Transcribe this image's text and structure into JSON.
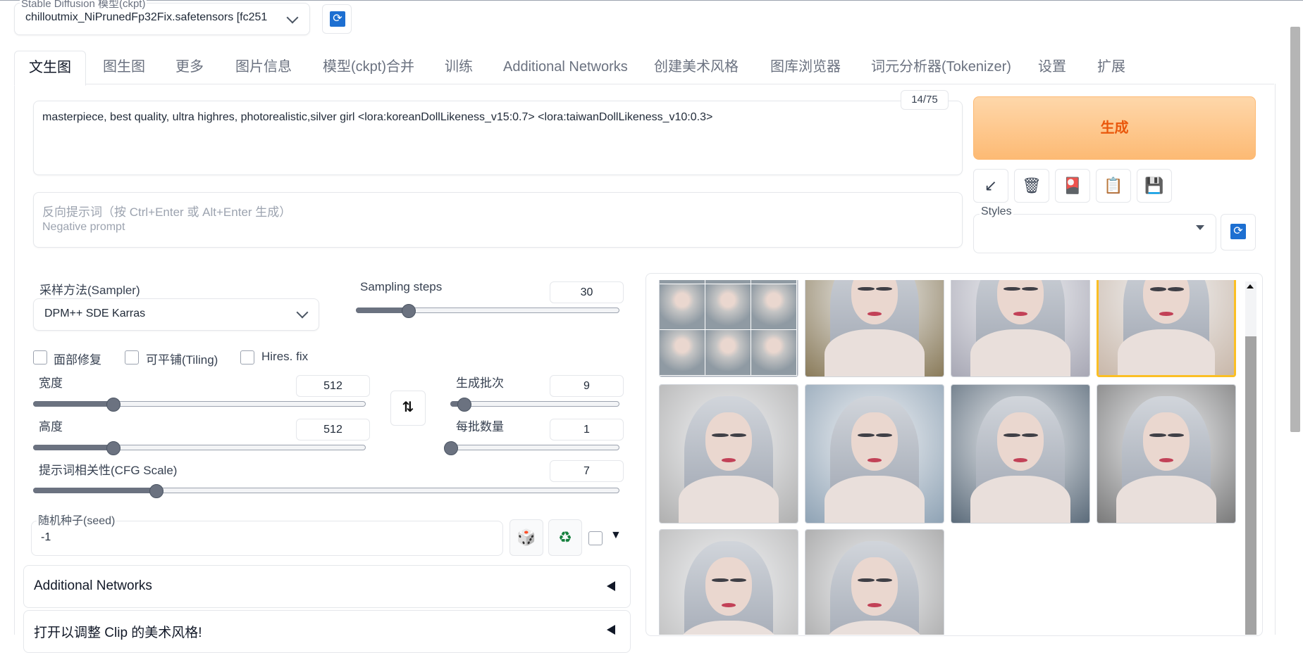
{
  "model": {
    "label": "Stable Diffusion 模型(ckpt)",
    "value": "chilloutmix_NiPrunedFp32Fix.safetensors [fc251"
  },
  "tabs": [
    {
      "label": "文生图",
      "active": true
    },
    {
      "label": "图生图"
    },
    {
      "label": "更多"
    },
    {
      "label": "图片信息"
    },
    {
      "label": "模型(ckpt)合并"
    },
    {
      "label": "训练"
    },
    {
      "label": "Additional Networks"
    },
    {
      "label": "创建美术风格"
    },
    {
      "label": "图库浏览器"
    },
    {
      "label": "词元分析器(Tokenizer)"
    },
    {
      "label": "设置"
    },
    {
      "label": "扩展"
    }
  ],
  "prompt": {
    "value": "masterpiece, best quality, ultra highres, photorealistic,silver girl <lora:koreanDollLikeness_v15:0.7> <lora:taiwanDollLikeness_v10:0.3>",
    "token_count": "14/75"
  },
  "negative_prompt": {
    "placeholder_line1": "反向提示词（按 Ctrl+Enter 或 Alt+Enter 生成）",
    "placeholder_line2": "Negative prompt"
  },
  "generate": {
    "label": "生成"
  },
  "tools": {
    "icons": [
      "arrow-icon",
      "trash-icon",
      "card-icon",
      "clipboard-icon",
      "save-icon"
    ],
    "glyphs": [
      "↙",
      "🗑",
      "🎴",
      "📋",
      "💾"
    ]
  },
  "styles": {
    "label": "Styles",
    "value": ""
  },
  "sampler": {
    "label": "采样方法(Sampler)",
    "value": "DPM++ SDE Karras"
  },
  "sampling_steps": {
    "label": "Sampling steps",
    "value": "30",
    "fraction": 0.2
  },
  "checkboxes": {
    "restore_faces": "面部修复",
    "tiling": "可平铺(Tiling)",
    "hires_fix": "Hires. fix"
  },
  "width": {
    "label": "宽度",
    "value": "512",
    "fraction": 0.24
  },
  "height": {
    "label": "高度",
    "value": "512",
    "fraction": 0.24
  },
  "batch_count": {
    "label": "生成批次",
    "value": "9",
    "fraction": 0.08
  },
  "batch_size": {
    "label": "每批数量",
    "value": "1",
    "fraction": 0.0
  },
  "cfg_scale": {
    "label": "提示词相关性(CFG Scale)",
    "value": "7",
    "fraction": 0.21
  },
  "swap_glyph": "⇅",
  "seed": {
    "label": "随机种子(seed)",
    "value": "-1",
    "dice_glyph": "🎲",
    "recycle_glyph": "♻",
    "extra_glyph": "▼"
  },
  "accordions": {
    "additional_networks": "Additional Networks",
    "clip_style": "打开以调整 Clip 的美术风格!"
  },
  "gallery": {
    "images": [
      {
        "name": "grid",
        "tone": "#9ca3af"
      },
      {
        "name": "image-1",
        "tone": "#8a7b5a"
      },
      {
        "name": "image-2",
        "tone": "#a8a8b5"
      },
      {
        "name": "image-3",
        "tone": "#c9b8aa",
        "selected": true
      },
      {
        "name": "image-4",
        "tone": "#b0b0b0"
      },
      {
        "name": "image-5",
        "tone": "#8fa3b5"
      },
      {
        "name": "image-6",
        "tone": "#5b6b7a"
      },
      {
        "name": "image-7",
        "tone": "#7a7a7a"
      },
      {
        "name": "image-8",
        "tone": "#b8b8b8"
      },
      {
        "name": "image-9",
        "tone": "#a0a0a0"
      }
    ]
  },
  "colors": {
    "accent": "#ea580c",
    "generate_bg": "#fdba74",
    "refresh_icon": "#1d6fd1",
    "selected_border": "#fbbf24"
  }
}
